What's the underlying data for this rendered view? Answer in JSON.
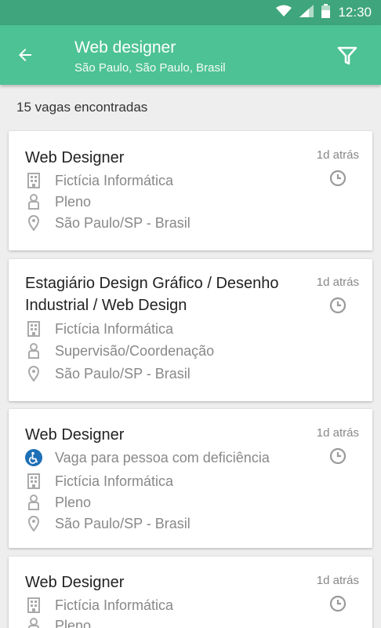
{
  "status_bar": {
    "time": "12:30"
  },
  "app_bar": {
    "title": "Web designer",
    "subtitle": "São Paulo, São Paulo, Brasil"
  },
  "results": {
    "count_label": "15 vagas encontradas"
  },
  "jobs": [
    {
      "title": "Web Designer",
      "time_ago": "1d atrás",
      "company": "Fictícia Informática",
      "level": "Pleno",
      "location": "São Paulo/SP - Brasil"
    },
    {
      "title": "Estagiário Design Gráfico / Desenho Industrial / Web Design",
      "time_ago": "1d atrás",
      "company": "Fictícia Informática",
      "level": "Supervisão/Coordenação",
      "location": "São Paulo/SP - Brasil"
    },
    {
      "title": "Web Designer",
      "time_ago": "1d atrás",
      "pcd": "Vaga para pessoa com deficiência",
      "company": "Fictícia Informática",
      "level": "Pleno",
      "location": "São Paulo/SP - Brasil"
    },
    {
      "title": "Web Designer",
      "time_ago": "1d atrás",
      "company": "Fictícia Informática",
      "level": "Pleno"
    }
  ],
  "colors": {
    "primary": "#4dc294",
    "status_bar": "#3fa57c",
    "accessibility": "#1e6fb5"
  },
  "icons": [
    "wifi-icon",
    "signal-icon",
    "battery-icon",
    "back-arrow-icon",
    "filter-icon",
    "building-icon",
    "person-icon",
    "location-pin-icon",
    "clock-icon",
    "accessibility-icon"
  ]
}
